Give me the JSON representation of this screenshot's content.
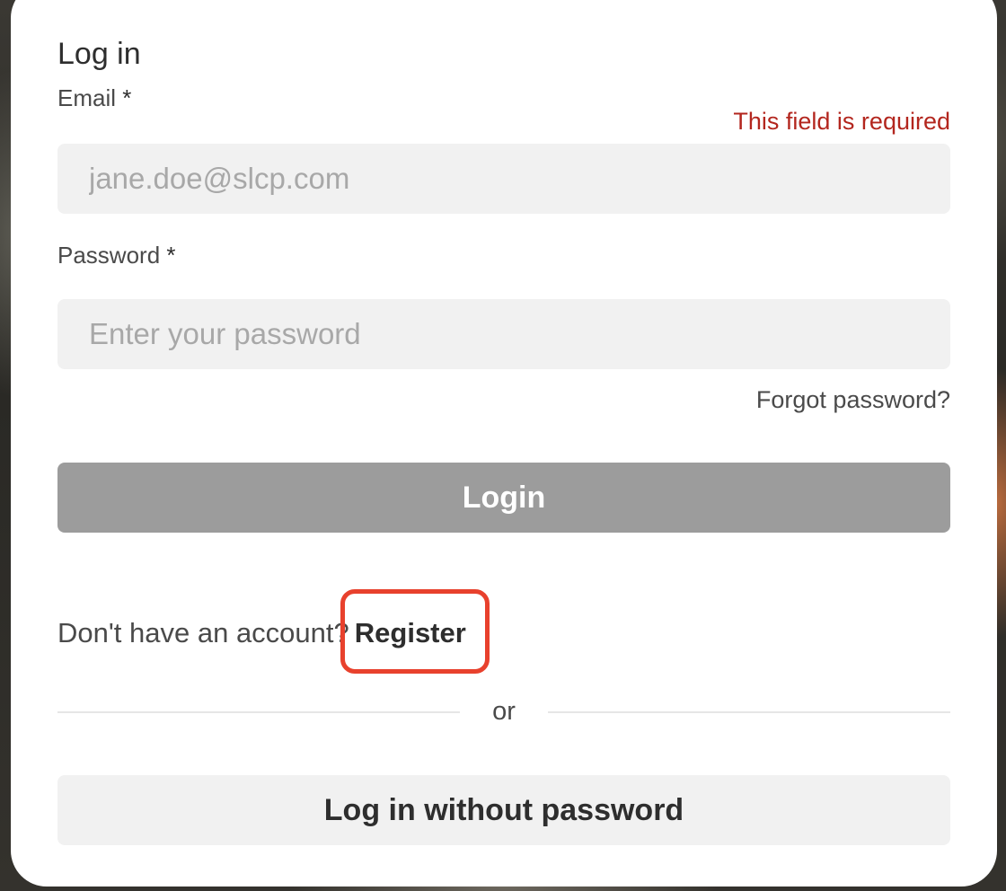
{
  "form": {
    "title": "Log in",
    "email": {
      "label": "Email",
      "required_mark": "*",
      "placeholder": "jane.doe@slcp.com",
      "value": "",
      "error": "This field is required"
    },
    "password": {
      "label": "Password",
      "required_mark": "*",
      "placeholder": "Enter your password",
      "value": ""
    },
    "forgot_password": "Forgot password?",
    "login_button": "Login",
    "register_prompt": "Don't have an account?",
    "register_link": "Register",
    "divider_text": "or",
    "passwordless_button": "Log in without password"
  },
  "colors": {
    "error": "#b3261e",
    "login_button_disabled": "#9c9c9c",
    "highlight": "#e8412d",
    "input_bg": "#f1f1f1"
  }
}
